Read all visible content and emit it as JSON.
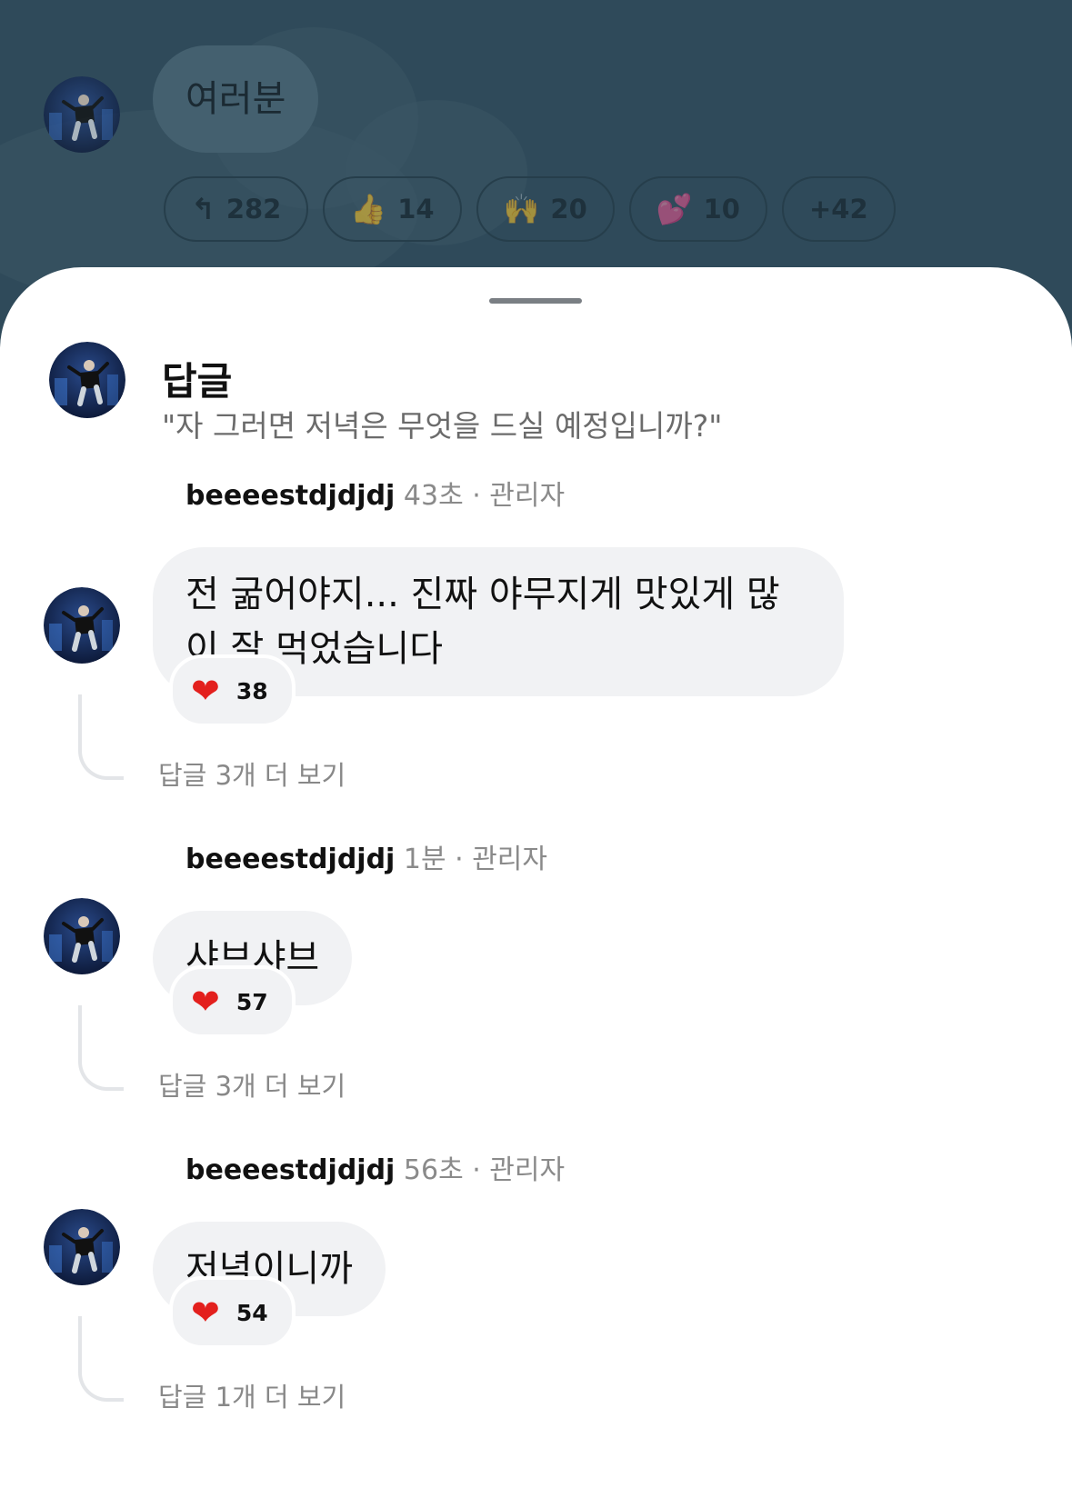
{
  "post": {
    "bubble_text": "여러분",
    "reactions": [
      {
        "icon": "reply-icon",
        "glyph": "↰",
        "count": "282"
      },
      {
        "icon": "thumbs-up-icon",
        "glyph": "👍",
        "count": "14"
      },
      {
        "icon": "raised-hands-icon",
        "glyph": "🙌",
        "count": "20"
      },
      {
        "icon": "two-hearts-icon",
        "glyph": "💕",
        "count": "10"
      },
      {
        "icon": "more-reactions",
        "glyph": "",
        "count": "+42"
      }
    ]
  },
  "sheet": {
    "title": "답글",
    "quoted": "\"자 그러면 저녁은 무엇을 드실 예정입니까?\""
  },
  "replies": [
    {
      "user": "beeeestdjdjdj",
      "time": "43초",
      "role": "· 관리자",
      "text": "전 굶어야지... 진짜 야무지게 맛있게 많이 잘 먹었습니다",
      "likes": "38",
      "more": "답글 3개 더 보기"
    },
    {
      "user": "beeeestdjdjdj",
      "time": "1분",
      "role": "· 관리자",
      "text": "샤브샤브",
      "likes": "57",
      "more": "답글 3개 더 보기"
    },
    {
      "user": "beeeestdjdjdj",
      "time": "56초",
      "role": "· 관리자",
      "text": "저녁이니까",
      "likes": "54",
      "more": "답글 1개 더 보기"
    }
  ],
  "colors": {
    "heart": "#e3201d",
    "background": "#2f4a5a",
    "bubble": "#f1f2f4"
  }
}
